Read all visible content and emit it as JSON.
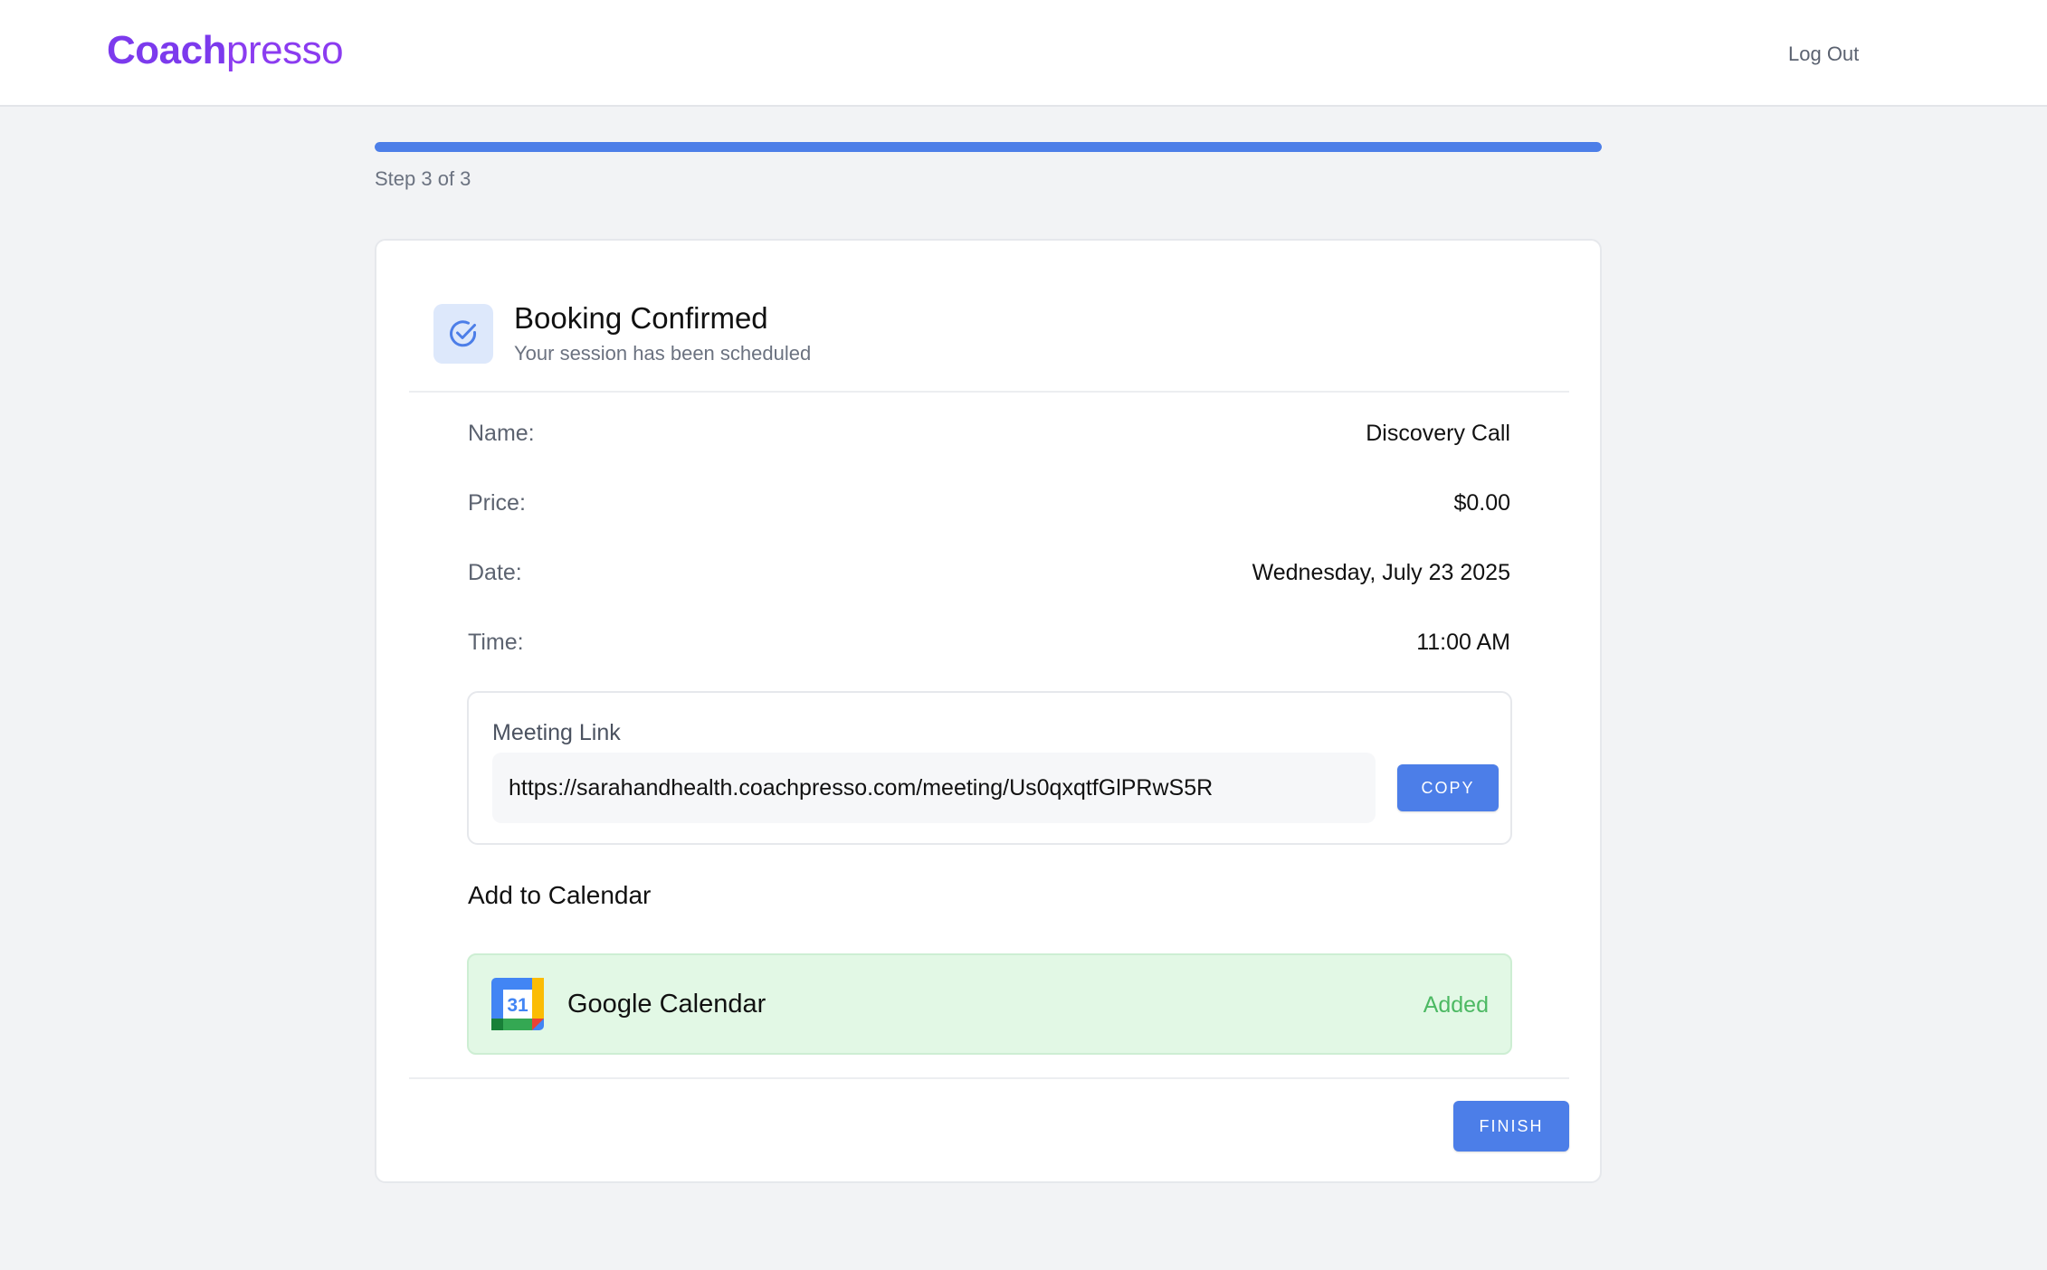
{
  "header": {
    "logo_bold": "Coach",
    "logo_light": "presso",
    "logout_label": "Log Out"
  },
  "progress": {
    "fraction": 1.0,
    "step_text": "Step 3 of 3"
  },
  "confirmation": {
    "title": "Booking Confirmed",
    "subtitle": "Your session has been scheduled",
    "icon": "check-circle-icon"
  },
  "details": [
    {
      "label": "Name:",
      "value": "Discovery Call"
    },
    {
      "label": "Price:",
      "value": "$0.00"
    },
    {
      "label": "Date:",
      "value": "Wednesday, July 23 2025"
    },
    {
      "label": "Time:",
      "value": "11:00 AM"
    }
  ],
  "meeting": {
    "label": "Meeting Link",
    "url": "https://sarahandhealth.coachpresso.com/meeting/Us0qxqtfGlPRwS5R",
    "copy_label": "COPY"
  },
  "calendar": {
    "heading": "Add to Calendar",
    "items": [
      {
        "icon": "google-calendar-icon",
        "icon_day": "31",
        "name": "Google Calendar",
        "status": "Added"
      }
    ]
  },
  "actions": {
    "finish_label": "FINISH"
  },
  "colors": {
    "brand": "#7c3aed",
    "accent": "#4c7ee8",
    "success": "#4cb963",
    "success_bg": "#e2f8e5"
  }
}
